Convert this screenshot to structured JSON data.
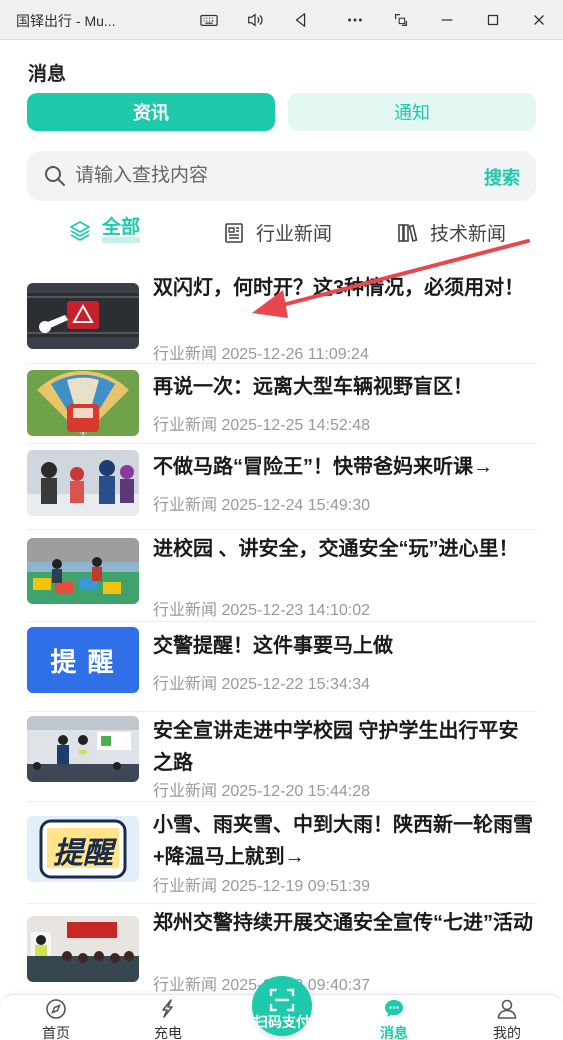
{
  "window": {
    "title": "国铎出行 - Mu...",
    "buttons": [
      "keyboard-icon",
      "volume-icon",
      "back-icon",
      "more-icon",
      "screenshot-icon",
      "minimize-icon",
      "maximize-icon",
      "close-icon"
    ]
  },
  "header": {
    "title": "消息"
  },
  "tabs": [
    {
      "label": "资讯",
      "active": true
    },
    {
      "label": "通知",
      "active": false
    }
  ],
  "search": {
    "placeholder": "请输入查找内容",
    "button": "搜索"
  },
  "categories": [
    {
      "label": "全部",
      "icon": "layers-icon",
      "active": true
    },
    {
      "label": "行业新闻",
      "icon": "newspaper-icon",
      "active": false
    },
    {
      "label": "技术新闻",
      "icon": "books-icon",
      "active": false
    }
  ],
  "news": [
    {
      "title": "双闪灯，何时开？这3种情况，必须用对！",
      "category": "行业新闻",
      "date": "2025-12-26 11:09:24"
    },
    {
      "title": "再说一次：远离大型车辆视野盲区！",
      "category": "行业新闻",
      "date": "2025-12-25 14:52:48"
    },
    {
      "title": "不做马路“冒险王”！快带爸妈来听课→",
      "category": "行业新闻",
      "date": "2025-12-24 15:49:30"
    },
    {
      "title": "进校园 、讲安全，交通安全“玩”进心里！",
      "category": "行业新闻",
      "date": "2025-12-23 14:10:02"
    },
    {
      "title": "交警提醒！这件事要马上做",
      "category": "行业新闻",
      "date": "2025-12-22 15:34:34",
      "thumb_text": "提 醒"
    },
    {
      "title": "安全宣讲走进中学校园 守护学生出行平安之路",
      "category": "行业新闻",
      "date": "2025-12-20 15:44:28"
    },
    {
      "title": "小雪、雨夹雪、中到大雨！陕西新一轮雨雪+降温马上就到→",
      "category": "行业新闻",
      "date": "2025-12-19 09:51:39",
      "thumb_text": "提醒"
    },
    {
      "title": "郑州交警持续开展交通安全宣传“七进”活动",
      "category": "行业新闻",
      "date": "2025-12-18 09:40:37"
    }
  ],
  "bottom_nav": [
    {
      "label": "首页",
      "icon": "compass-icon",
      "active": false
    },
    {
      "label": "充电",
      "icon": "charge-icon",
      "active": false
    },
    {
      "label": "扫码支付",
      "icon": "scan-icon",
      "active": false
    },
    {
      "label": "消息",
      "icon": "message-icon",
      "active": true
    },
    {
      "label": "我的",
      "icon": "user-icon",
      "active": false
    }
  ],
  "colors": {
    "accent": "#1fc9ac",
    "accent_light": "#e3f7f3",
    "annotation_arrow": "#e8474c"
  }
}
